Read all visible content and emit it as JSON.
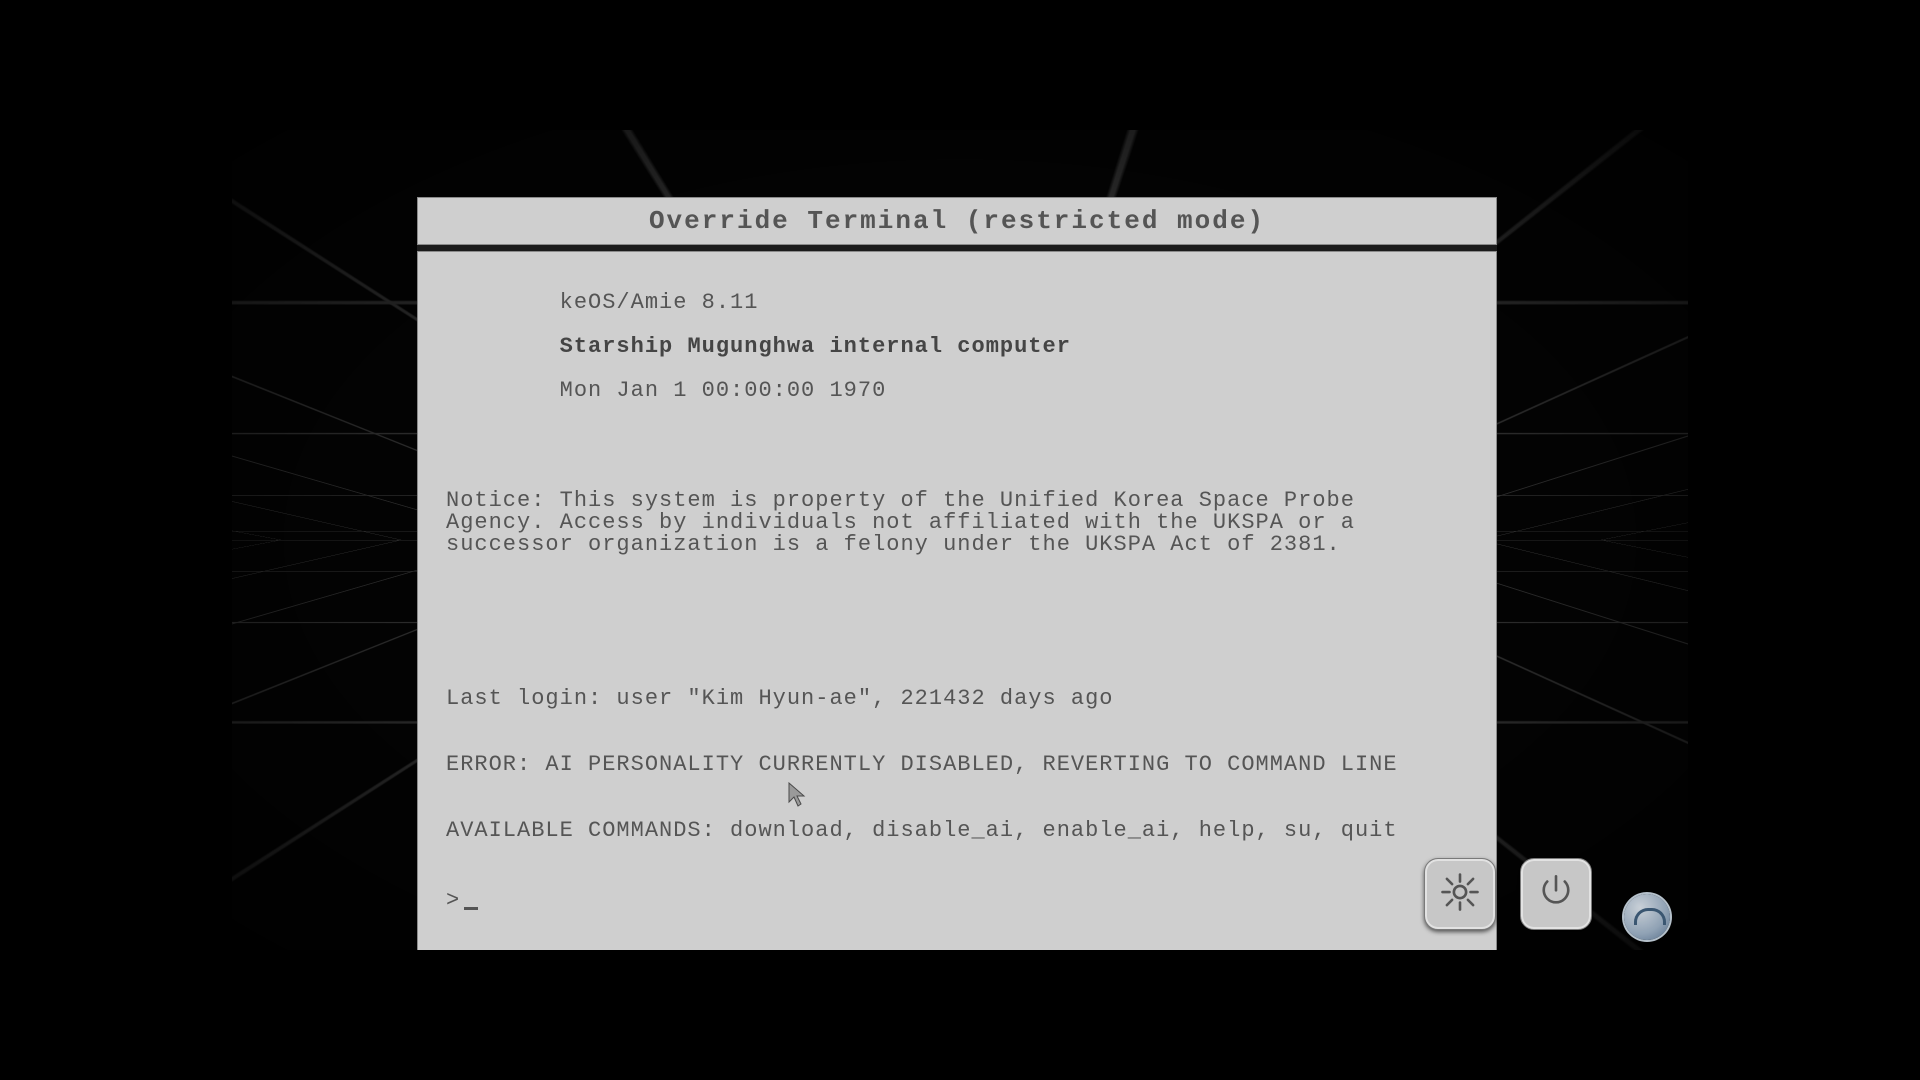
{
  "window": {
    "title": "Override Terminal (restricted mode)"
  },
  "header": {
    "os": "keOS/Amie 8.11",
    "ship": "Starship Mugunghwa internal computer",
    "datetime": "Mon Jan 1 00:00:00 1970"
  },
  "notice": "Notice: This system is property of the Unified Korea Space Probe Agency. Access by individuals not affiliated with the UKSPA or a successor organization is a felony under the UKSPA Act of 2381.",
  "log": {
    "last_login": "Last login: user \"Kim Hyun-ae\", 221432 days ago",
    "error": "ERROR: AI PERSONALITY CURRENTLY DISABLED, REVERTING TO COMMAND LINE",
    "available": "AVAILABLE COMMANDS: download, disable_ai, enable_ai, help, su, quit"
  },
  "prompt": {
    "symbol": ">",
    "value": ""
  },
  "hud": {
    "settings_label": "settings",
    "power_label": "power"
  }
}
